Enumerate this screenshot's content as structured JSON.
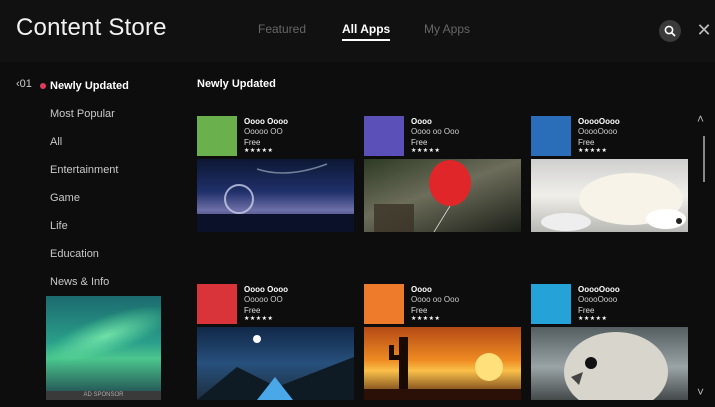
{
  "header": {
    "title": "Content Store",
    "tabs": [
      {
        "label": "Featured",
        "active": false
      },
      {
        "label": "All Apps",
        "active": true
      },
      {
        "label": "My Apps",
        "active": false
      }
    ],
    "search_icon": "search-icon",
    "close_icon": "close-icon",
    "close_glyph": "✕"
  },
  "sidebar": {
    "page_indicator": "‹01",
    "items": [
      {
        "label": "Newly Updated",
        "active": true
      },
      {
        "label": "Most Popular",
        "active": false
      },
      {
        "label": "All",
        "active": false
      },
      {
        "label": "Entertainment",
        "active": false
      },
      {
        "label": "Game",
        "active": false
      },
      {
        "label": "Life",
        "active": false
      },
      {
        "label": "Education",
        "active": false
      },
      {
        "label": "News & Info",
        "active": false
      }
    ],
    "ad_label": "AD SPONSOR"
  },
  "main": {
    "section_title": "Newly Updated",
    "apps": [
      {
        "name": "Oooo Oooo",
        "subname": "Ooooo OO",
        "price": "Free",
        "rating": "★★★★★",
        "color": "#6ab04c",
        "screenshot": "space-landscape"
      },
      {
        "name": "Oooo",
        "subname": "Oooo oo Ooo",
        "price": "Free",
        "rating": "★★★★★",
        "color": "#5b4fb8",
        "screenshot": "red-balloon"
      },
      {
        "name": "OoooOooo",
        "subname": "OoooOooo",
        "price": "Free",
        "rating": "★★★★★",
        "color": "#2a6db8",
        "screenshot": "sleeping-dog"
      },
      {
        "name": "Oooo Oooo",
        "subname": "Ooooo OO",
        "price": "Free",
        "rating": "★★★★★",
        "color": "#d9343a",
        "screenshot": "night-camp"
      },
      {
        "name": "Oooo",
        "subname": "Oooo oo Ooo",
        "price": "Free",
        "rating": "★★★★★",
        "color": "#ee7a2c",
        "screenshot": "desert-sunset"
      },
      {
        "name": "OoooOooo",
        "subname": "OoooOooo",
        "price": "Free",
        "rating": "★★★★★",
        "color": "#25a2d8",
        "screenshot": "owl"
      }
    ]
  },
  "scrollbar": {
    "up_glyph": "˄",
    "down_glyph": "˅"
  }
}
